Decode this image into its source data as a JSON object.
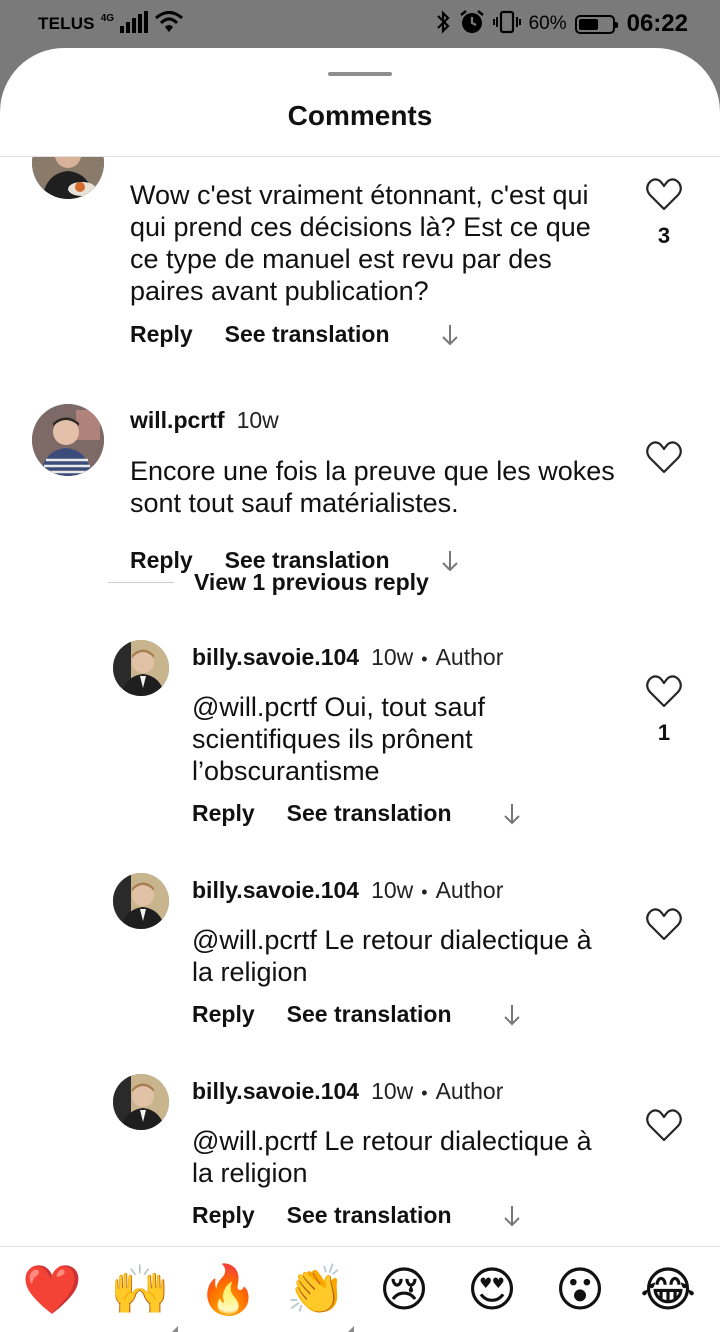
{
  "status_bar": {
    "carrier": "TELUS",
    "network": "4G",
    "battery_percent": "60%",
    "time": "06:22",
    "icons": [
      "signal-icon",
      "wifi-icon",
      "bluetooth-icon",
      "alarm-icon",
      "vibrate-icon",
      "battery-icon"
    ]
  },
  "sheet": {
    "title": "Comments"
  },
  "comments": [
    {
      "username": "",
      "text": "Wow c'est vraiment étonnant, c'est qui qui prend ces décisions là? Est ce que ce type de manuel est revu par des paires avant publication?",
      "reply_label": "Reply",
      "translate_label": "See translation",
      "likes": "3"
    },
    {
      "username": "will.pcrtf",
      "time": "10w",
      "text": "Encore une fois la preuve que les wokes sont tout sauf matérialistes.",
      "reply_label": "Reply",
      "translate_label": "See translation",
      "likes": ""
    }
  ],
  "view_previous": "View 1 previous reply",
  "replies": [
    {
      "username": "billy.savoie.104",
      "time": "10w",
      "dot": "•",
      "author_badge": "Author",
      "text": "@will.pcrtf Oui, tout sauf scientifiques ils prônent l’obscurantisme",
      "reply_label": "Reply",
      "translate_label": "See translation",
      "likes": "1"
    },
    {
      "username": "billy.savoie.104",
      "time": "10w",
      "dot": "•",
      "author_badge": "Author",
      "text": "@will.pcrtf Le retour dialectique à la religion",
      "reply_label": "Reply",
      "translate_label": "See translation",
      "likes": ""
    },
    {
      "username": "billy.savoie.104",
      "time": "10w",
      "dot": "•",
      "author_badge": "Author",
      "text": "@will.pcrtf Le retour dialectique à la religion",
      "reply_label": "Reply",
      "translate_label": "See translation",
      "likes": ""
    }
  ],
  "emoji_bar": [
    "❤️",
    "🙌",
    "🔥",
    "👏",
    "😢",
    "😍",
    "😮",
    "😂"
  ],
  "colors": {
    "heart_outline": "#262626",
    "muted": "#8e8e8e"
  }
}
